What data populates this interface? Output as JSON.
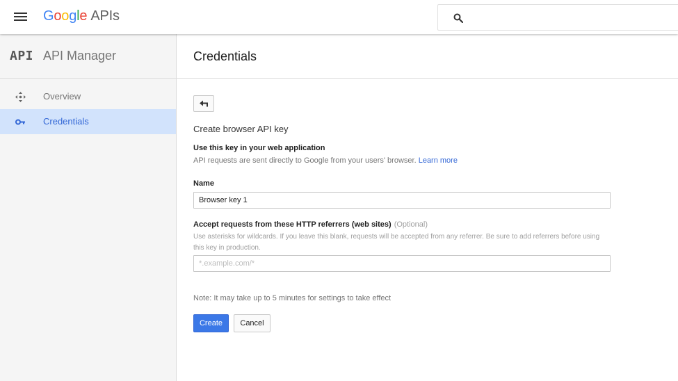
{
  "header": {
    "logo_parts": [
      "G",
      "o",
      "o",
      "g",
      "l",
      "e"
    ],
    "logo_suffix": "APIs",
    "menu_icon": "hamburger-menu-icon",
    "search_icon": "search-icon"
  },
  "sidebar": {
    "badge": "API",
    "title": "API Manager",
    "items": [
      {
        "label": "Overview",
        "icon": "move-arrows-icon",
        "active": false
      },
      {
        "label": "Credentials",
        "icon": "key-icon",
        "active": true
      }
    ]
  },
  "main": {
    "title": "Credentials",
    "back_icon": "back-arrow-icon",
    "form_title": "Create browser API key",
    "subtitle": "Use this key in your web application",
    "description": "API requests are sent directly to Google from your users' browser.",
    "learn_more": "Learn more",
    "name_label": "Name",
    "name_value": "Browser key 1",
    "referrers_label": "Accept requests from these HTTP referrers (web sites)",
    "referrers_optional": "(Optional)",
    "referrers_help": "Use asterisks for wildcards. If you leave this blank, requests will be accepted from any referrer. Be sure to add referrers before using this key in production.",
    "referrers_placeholder": "*.example.com/*",
    "referrers_value": "",
    "note": "Note: It may take up to 5 minutes for settings to take effect",
    "create_label": "Create",
    "cancel_label": "Cancel"
  },
  "colors": {
    "primary": "#3b78e7",
    "active_nav_bg": "#d2e3fc",
    "active_nav_text": "#3367d6",
    "link": "#3367d6"
  }
}
